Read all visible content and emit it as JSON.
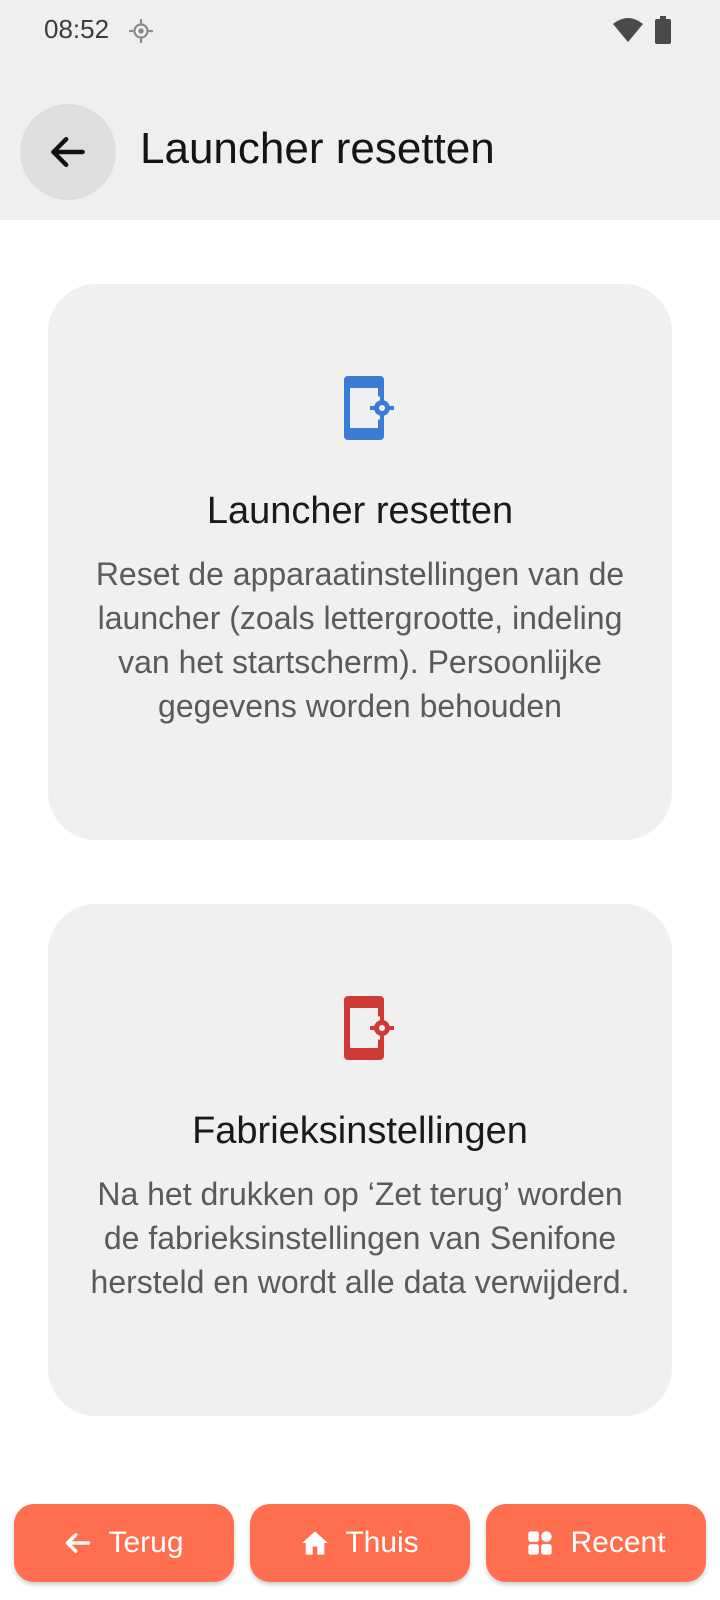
{
  "status": {
    "time": "08:52"
  },
  "header": {
    "title": "Launcher resetten"
  },
  "cards": [
    {
      "title": "Launcher resetten",
      "description": "Reset de apparaatinstellingen van de launcher (zoals lettergrootte, indeling van het startscherm). Persoonlijke gegevens worden behouden",
      "icon": "phone-settings-icon",
      "icon_color": "#3a7bd5"
    },
    {
      "title": "Fabrieksinstellingen",
      "description": "Na het drukken op ‘Zet terug’ worden de fabrieksinstellingen van Senifone hersteld en wordt alle data verwijderd.",
      "icon": "phone-settings-icon",
      "icon_color": "#cf3a36"
    }
  ],
  "nav": {
    "back_label": "Terug",
    "home_label": "Thuis",
    "recent_label": "Recent",
    "accent": "#ff6e4e"
  }
}
